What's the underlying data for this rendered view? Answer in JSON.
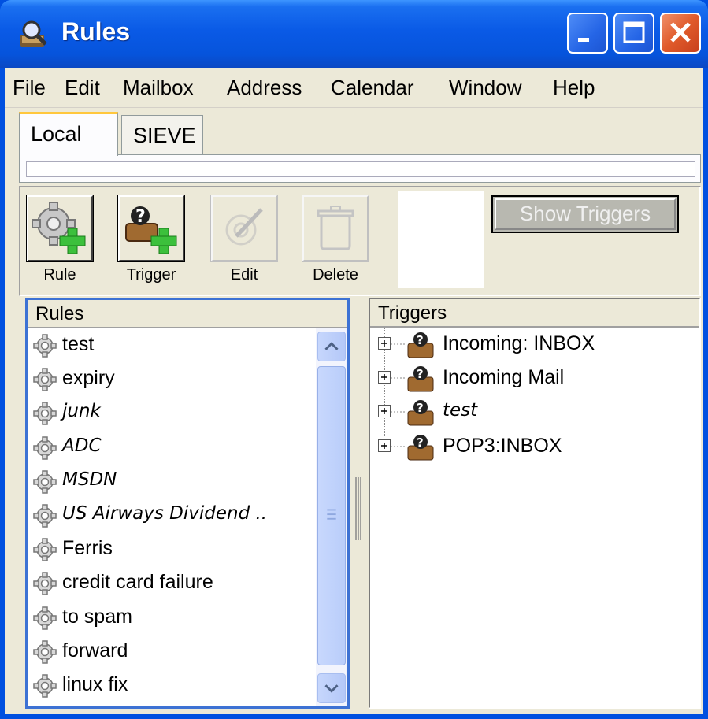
{
  "window": {
    "title": "Rules",
    "colors": {
      "titlebar": "#0a5ae6",
      "close": "#e05a2a",
      "face": "#ece9d8",
      "focus_border": "#3d72d4"
    }
  },
  "menubar": {
    "items": [
      "File",
      "Edit",
      "Mailbox",
      "Address",
      "Calendar",
      "Window",
      "Help"
    ]
  },
  "tabs": {
    "local": "Local",
    "sieve": "SIEVE",
    "active": "Local"
  },
  "toolbar": {
    "rule_label": "Rule",
    "trigger_label": "Trigger",
    "edit_label": "Edit",
    "delete_label": "Delete",
    "show_triggers_label": "Show Triggers",
    "edit_enabled": false,
    "delete_enabled": false,
    "show_triggers_enabled": false
  },
  "rules": {
    "header": "Rules",
    "items": [
      {
        "label": "test",
        "italic": false
      },
      {
        "label": "expiry",
        "italic": false
      },
      {
        "label": "junk",
        "italic": true
      },
      {
        "label": "ADC",
        "italic": true
      },
      {
        "label": "MSDN",
        "italic": true
      },
      {
        "label": "US Airways Dividend ..",
        "italic": true
      },
      {
        "label": "Ferris",
        "italic": false
      },
      {
        "label": "credit card failure",
        "italic": false
      },
      {
        "label": "to spam",
        "italic": false
      },
      {
        "label": "forward",
        "italic": false
      },
      {
        "label": "linux fix",
        "italic": false
      }
    ]
  },
  "triggers": {
    "header": "Triggers",
    "items": [
      {
        "label": "Incoming: INBOX",
        "italic": false
      },
      {
        "label": "Incoming Mail",
        "italic": false
      },
      {
        "label": "test",
        "italic": true
      },
      {
        "label": "POP3:INBOX",
        "italic": false
      }
    ]
  },
  "icons": {
    "app": "magnifier-mail-icon",
    "rule": "gear-icon",
    "trigger": "trigger-person-icon",
    "expand": "plus-box-icon"
  }
}
